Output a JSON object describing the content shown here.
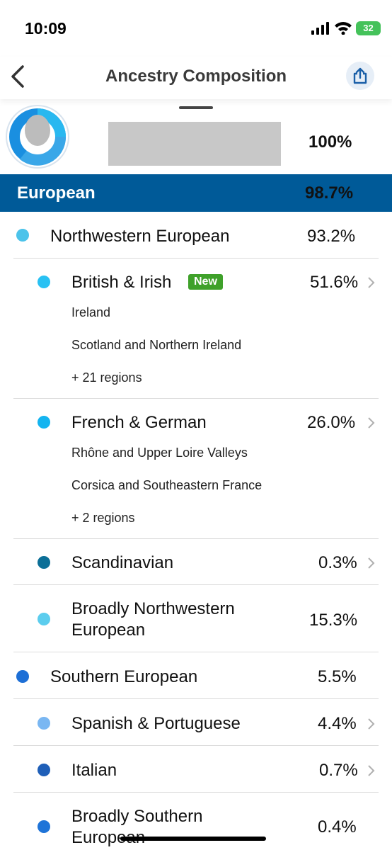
{
  "status_bar": {
    "time": "10:09",
    "battery": "32"
  },
  "navbar": {
    "title": "Ancestry Composition"
  },
  "summary": {
    "total_percent": "100%"
  },
  "region": {
    "name": "European",
    "percent": "98.7%",
    "color": "#005a98"
  },
  "groups": [
    {
      "label": "Northwestern European",
      "percent": "93.2%",
      "color": "#4cc3ea",
      "items": [
        {
          "label": "British & Irish",
          "badge": "New",
          "percent": "51.6%",
          "color": "#29c1f3",
          "sub": [
            "Ireland",
            "Scotland and Northern Ireland",
            "+ 21 regions"
          ]
        },
        {
          "label": "French & German",
          "percent": "26.0%",
          "color": "#14b4f0",
          "sub": [
            "Rhône and Upper Loire Valleys",
            "Corsica and  Southeastern France",
            "+ 2 regions"
          ]
        },
        {
          "label": "Scandinavian",
          "percent": "0.3%",
          "color": "#0c6f97"
        },
        {
          "label_line1": "Broadly Northwestern",
          "label_line2": "European",
          "percent": "15.3%",
          "color": "#5ccdee"
        }
      ]
    },
    {
      "label": "Southern European",
      "percent": "5.5%",
      "color": "#1d6fd6",
      "items": [
        {
          "label": "Spanish & Portuguese",
          "percent": "4.4%",
          "color": "#7ab7f2"
        },
        {
          "label": "Italian",
          "percent": "0.7%",
          "color": "#1f5fb8"
        },
        {
          "label_line1": "Broadly Southern",
          "label_line2": "European",
          "percent": "0.4%",
          "color": "#1f74d8"
        }
      ]
    }
  ]
}
